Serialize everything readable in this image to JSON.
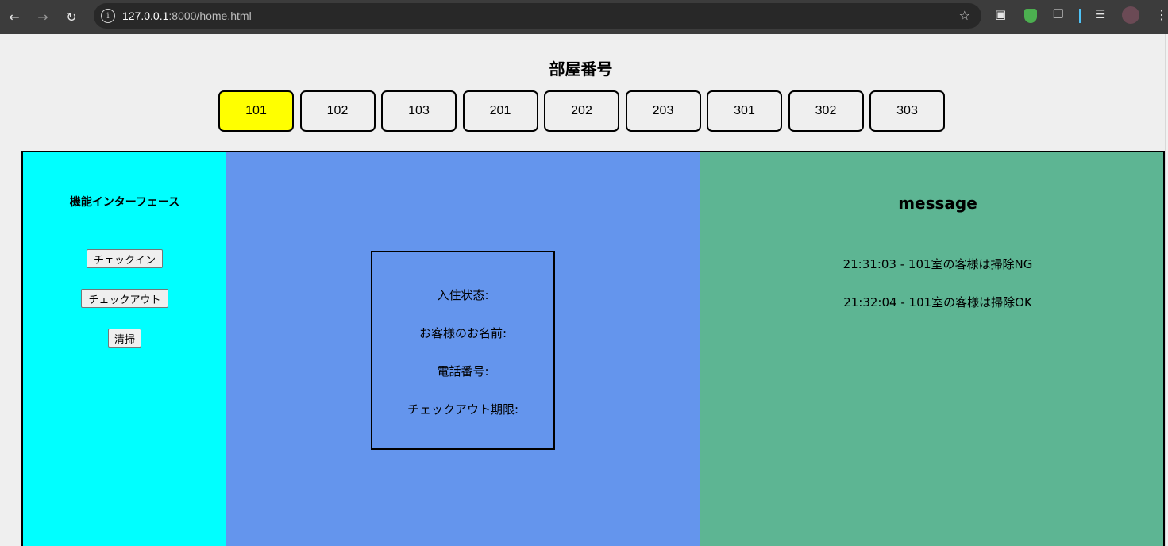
{
  "browser": {
    "url_host": "127.0.0.1",
    "url_rest": ":8000/home.html"
  },
  "header": {
    "title": "部屋番号"
  },
  "rooms": [
    "101",
    "102",
    "103",
    "201",
    "202",
    "203",
    "301",
    "302",
    "303"
  ],
  "selected_room": "101",
  "accent_color": "#ffff00",
  "functions": {
    "title": "機能インターフェース",
    "checkin_label": "チェックイン",
    "checkout_label": "チェックアウト",
    "clean_label": "清掃"
  },
  "info": {
    "status_label": "入住状态:",
    "name_label": "お客様のお名前:",
    "phone_label": "電話番号:",
    "deadline_label": "チェックアウト期限:"
  },
  "messages": {
    "title": "message",
    "items": [
      "21:31:03 - 101室の客様は掃除NG",
      "21:32:04 - 101室の客様は掃除OK"
    ]
  }
}
